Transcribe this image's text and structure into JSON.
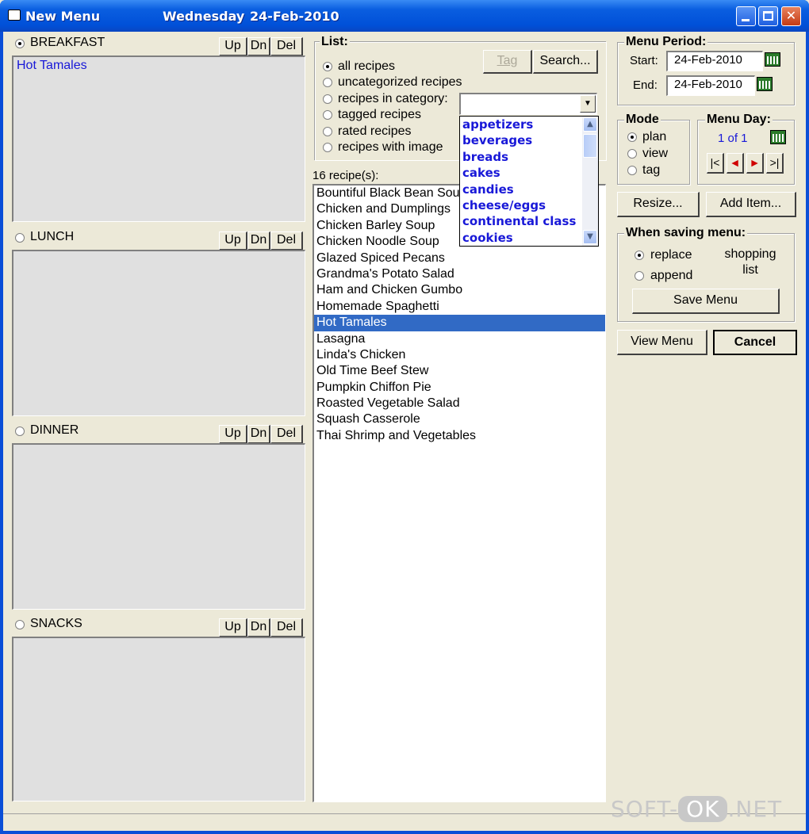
{
  "window": {
    "title": "New Menu",
    "day": "Wednesday",
    "date": "24-Feb-2010",
    "accent": "#0050d8"
  },
  "meals": [
    {
      "label": "BREAKFAST",
      "selected": true,
      "items": [
        "Hot Tamales"
      ]
    },
    {
      "label": "LUNCH",
      "selected": false,
      "items": []
    },
    {
      "label": "DINNER",
      "selected": false,
      "items": []
    },
    {
      "label": "SNACKS",
      "selected": false,
      "items": []
    }
  ],
  "meal_buttons": {
    "up": "Up",
    "dn": "Dn",
    "del": "Del"
  },
  "list_group": {
    "title": "List:",
    "options": [
      "all recipes",
      "uncategorized recipes",
      "recipes in category:",
      "tagged recipes",
      "rated recipes",
      "recipes with image"
    ],
    "selected_index": 0,
    "tag_button": "Tag",
    "search_button": "Search...",
    "category_value": ""
  },
  "category_dropdown": [
    "appetizers",
    "beverages",
    "breads",
    "cakes",
    "candies",
    "cheese/eggs",
    "continental class",
    "cookies"
  ],
  "recipes": {
    "count_label": "16 recipe(s):",
    "items": [
      "Bountiful Black Bean Soup",
      "Chicken and Dumplings",
      "Chicken Barley Soup",
      "Chicken Noodle Soup",
      "Glazed Spiced Pecans",
      "Grandma's Potato Salad",
      "Ham and Chicken Gumbo",
      "Homemade Spaghetti",
      "Hot Tamales",
      "Lasagna",
      "Linda's Chicken",
      "Old Time Beef Stew",
      "Pumpkin Chiffon Pie",
      "Roasted Vegetable Salad",
      "Squash Casserole",
      "Thai Shrimp and Vegetables"
    ],
    "selected_index": 8
  },
  "menu_period": {
    "title": "Menu Period:",
    "start_label": "Start:",
    "start_value": "24-Feb-2010",
    "end_label": "End:",
    "end_value": "24-Feb-2010"
  },
  "mode": {
    "title": "Mode",
    "options": [
      "plan",
      "view",
      "tag"
    ],
    "selected_index": 0
  },
  "menu_day": {
    "title": "Menu Day:",
    "value": "1 of 1",
    "nav": [
      "|<",
      "◄",
      "►",
      ">|"
    ]
  },
  "actions": {
    "resize": "Resize...",
    "add_item": "Add Item...",
    "view_menu": "View Menu",
    "cancel": "Cancel"
  },
  "saving": {
    "title": "When saving menu:",
    "options": [
      "replace",
      "append"
    ],
    "selected_index": 0,
    "shopping_list": "shopping list",
    "save_button": "Save Menu"
  },
  "watermark": {
    "left": "SOFT-",
    "ok": "OK",
    "right": ".NET"
  }
}
